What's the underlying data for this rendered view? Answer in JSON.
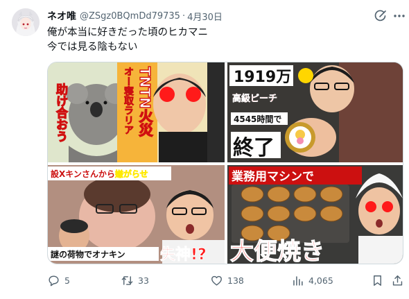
{
  "post": {
    "author_name": "ネオ唯",
    "handle": "@ZSgz0BQmDd79735",
    "separator": "·",
    "date": "4月30日",
    "text_line1": "俺が本当に好きだった頃のヒカマニ",
    "text_line2": "今では見る陰もない"
  },
  "thumbnails": {
    "top_left": {
      "vertical_title": "オー寝取ラリア",
      "vertical_main": "TNTN火災",
      "side_text": "助け合おう"
    },
    "top_right": {
      "count": "1919万",
      "subtitle": "高級ピーチ",
      "hours": "4545時間で",
      "big_text": "終了"
    },
    "bottom_left": {
      "top_caption_prefix": "設Xキンさんから",
      "top_caption_highlight": "嫌がらせ",
      "bottom_caption_prefix": "謎の荷物でオナキン",
      "bottom_caption_big": "失神!?"
    },
    "bottom_right": {
      "banner": "業務用マシンで",
      "big_text": "大便焼き"
    }
  },
  "actions": {
    "reply_count": "5",
    "repost_count": "33",
    "like_count": "138",
    "views_count": "4,065"
  },
  "icons": {
    "grok": "grok-icon",
    "more": "more-icon",
    "reply": "reply-icon",
    "repost": "repost-icon",
    "like": "like-icon",
    "views": "views-icon",
    "bookmark": "bookmark-icon",
    "share": "share-icon"
  },
  "colors": {
    "text_primary": "#0f1419",
    "text_secondary": "#536471",
    "border": "#cfd9de",
    "caption_red": "#e8141b",
    "caption_yellow": "#ffe600"
  }
}
